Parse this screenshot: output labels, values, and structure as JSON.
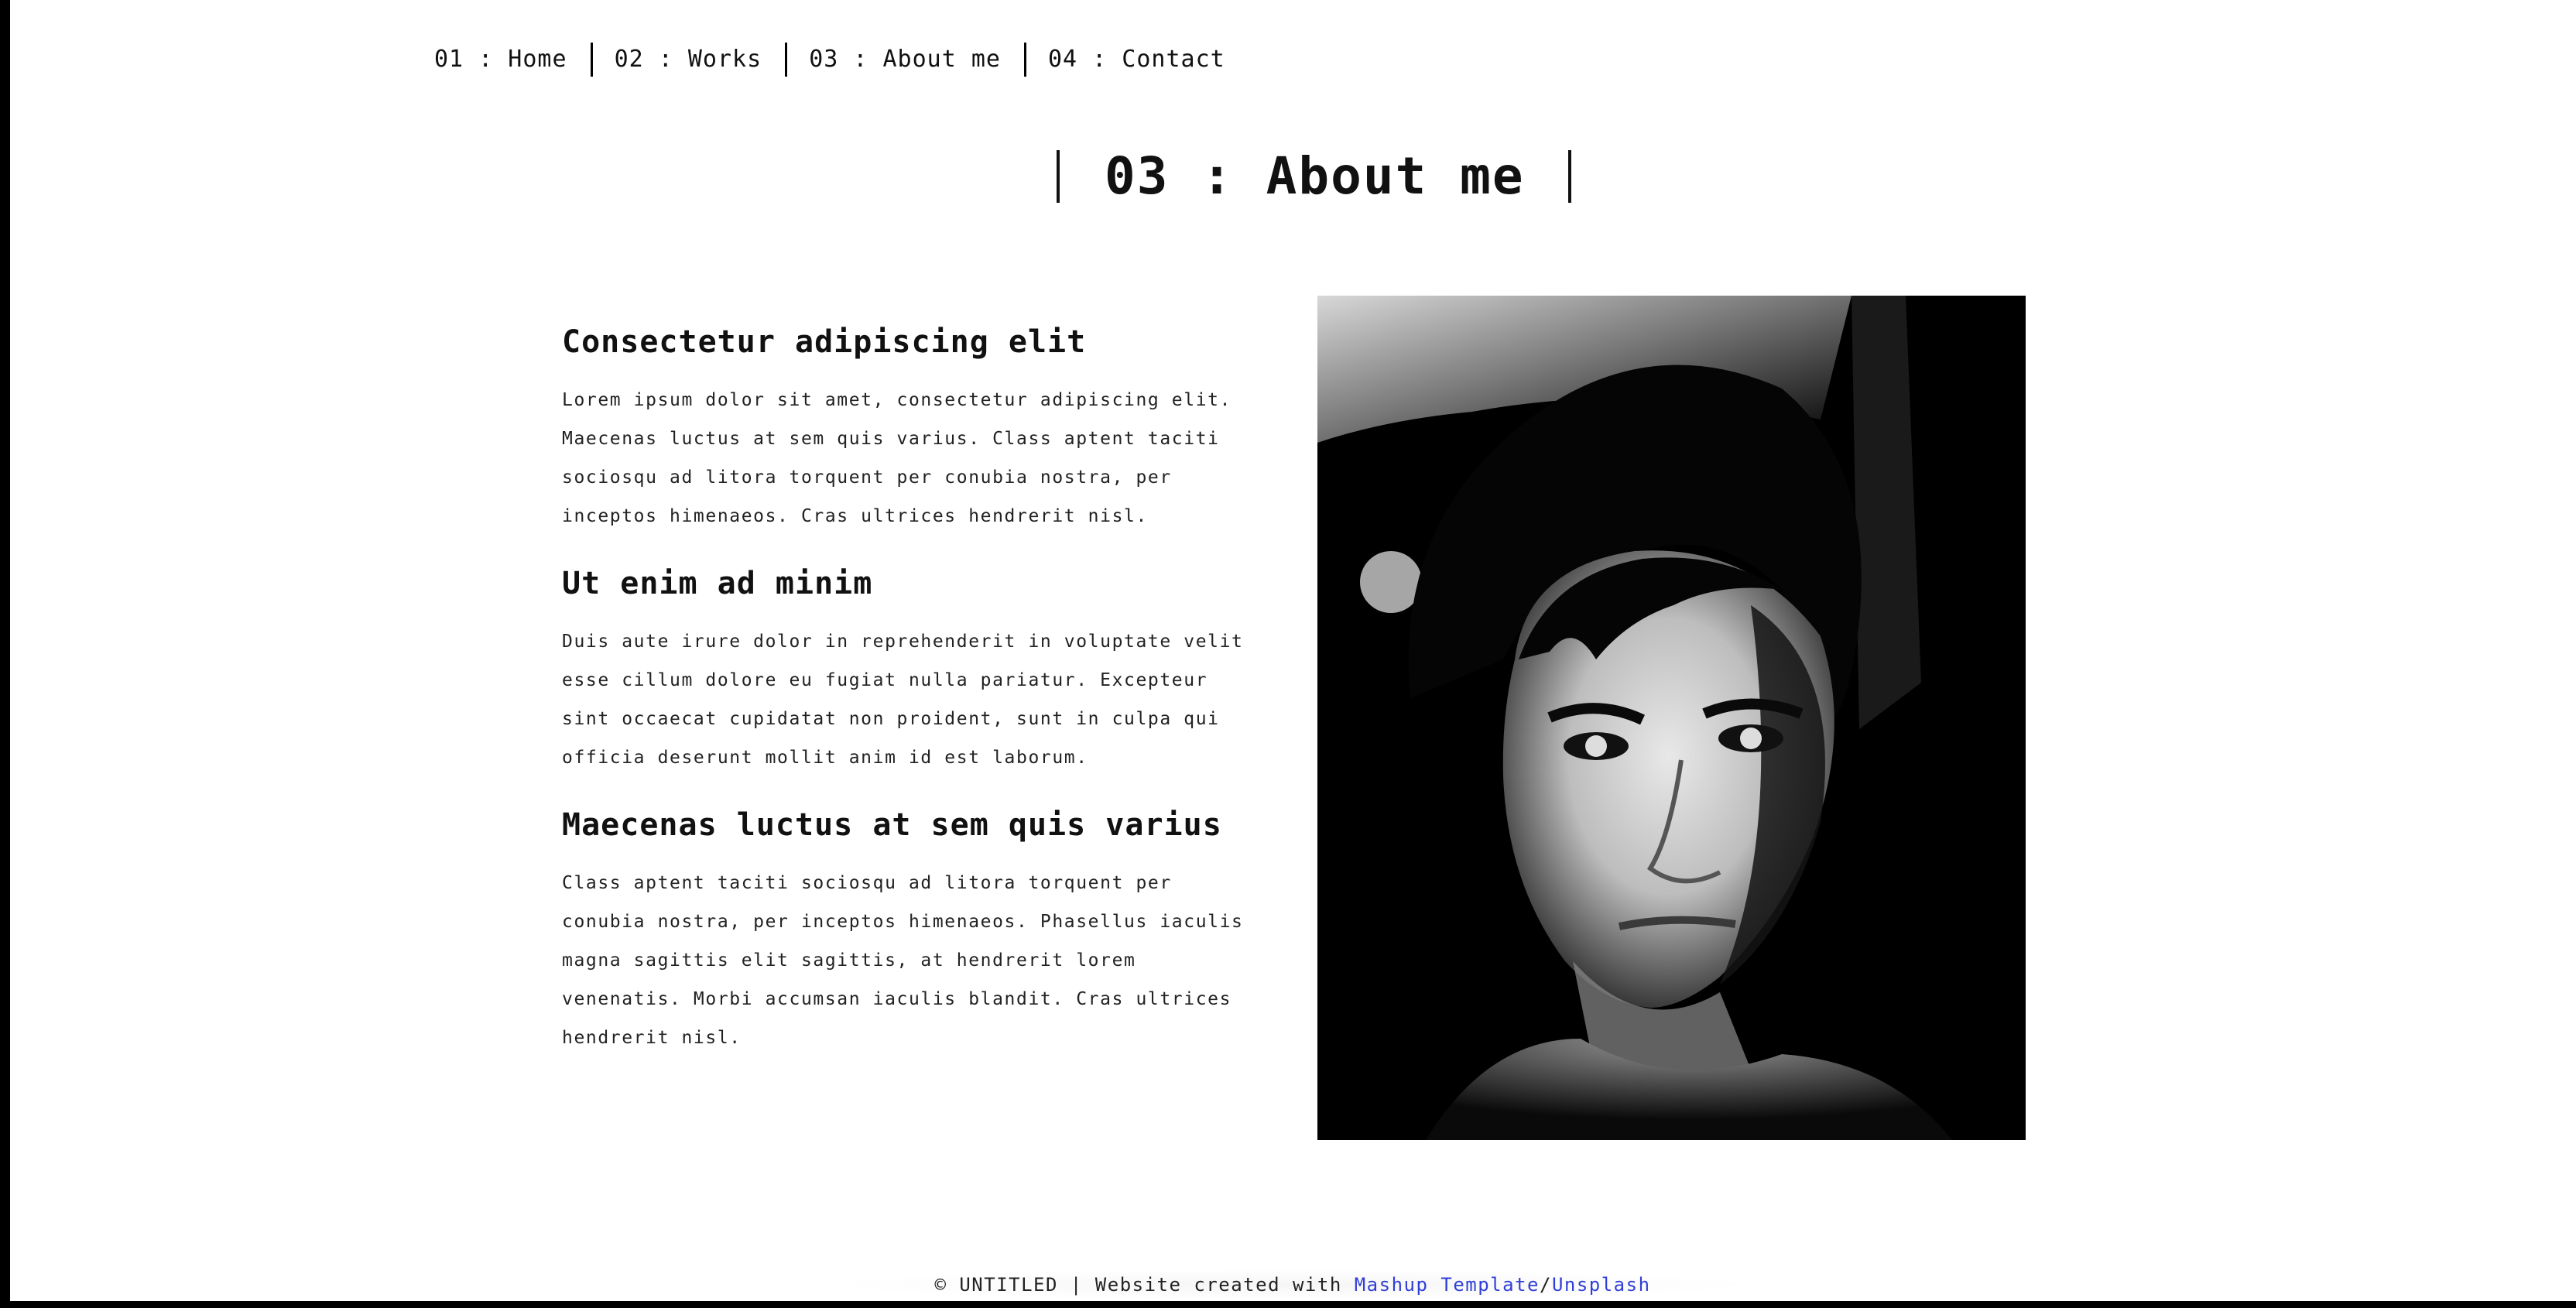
{
  "nav": {
    "items": [
      {
        "label": "01 : Home"
      },
      {
        "label": "02 : Works"
      },
      {
        "label": "03 : About me"
      },
      {
        "label": "04 : Contact"
      }
    ]
  },
  "page": {
    "title": "03 : About me"
  },
  "sections": [
    {
      "heading": "Consectetur adipiscing elit",
      "body": "Lorem ipsum dolor sit amet, consectetur adipiscing elit. Maecenas luctus at sem quis varius. Class aptent taciti sociosqu ad litora torquent per conubia nostra, per inceptos himenaeos. Cras ultrices hendrerit nisl."
    },
    {
      "heading": "Ut enim ad minim",
      "body": "Duis aute irure dolor in reprehenderit in voluptate velit esse cillum dolore eu fugiat nulla pariatur. Excepteur sint occaecat cupidatat non proident, sunt in culpa qui officia deserunt mollit anim id est laborum."
    },
    {
      "heading": "Maecenas luctus at sem quis varius",
      "body": "Class aptent taciti sociosqu ad litora torquent per conubia nostra, per inceptos himenaeos. Phasellus iaculis magna sagittis elit sagittis, at hendrerit lorem venenatis. Morbi accumsan iaculis blandit. Cras ultrices hendrerit nisl."
    }
  ],
  "footer": {
    "copyright": "© UNTITLED | Website created with ",
    "link1": "Mashup Template",
    "separator": "/",
    "link2": "Unsplash"
  },
  "colors": {
    "link": "#2f3fd6",
    "text": "#111111",
    "frame": "#000000"
  },
  "icons": {
    "portrait": "portrait-photo"
  }
}
